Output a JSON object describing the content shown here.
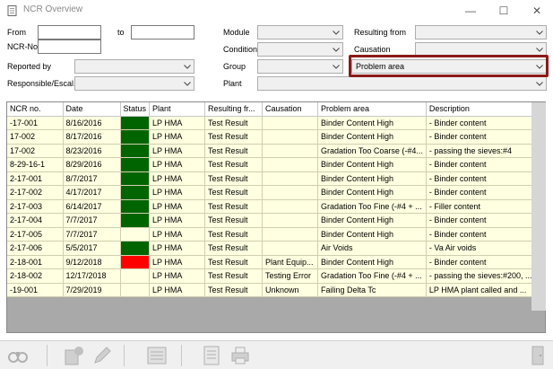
{
  "window": {
    "title": "NCR Overview",
    "minimize_glyph": "—",
    "maximize_glyph": "☐",
    "close_glyph": "✕"
  },
  "filters": {
    "from_label": "From",
    "to_label": "to",
    "ncr_no_label": "NCR-No.",
    "reported_by_label": "Reported by",
    "responsible_label": "Responsible/Escal.",
    "module_label": "Module",
    "condition_label": "Condition",
    "group_label": "Group",
    "plant_label": "Plant",
    "resulting_from_label": "Resulting from",
    "causation_label": "Causation",
    "problem_area_value": "Problem area"
  },
  "colors": {
    "row_bg": "#ffffe1",
    "status_green": "#006400",
    "status_red": "#ff0000",
    "highlight_border": "#8b1a1a"
  },
  "grid": {
    "columns": [
      "NCR no.",
      "Date",
      "Status",
      "Plant",
      "Resulting fr...",
      "Causation",
      "Problem area",
      "Description"
    ],
    "rows": [
      {
        "ncr": "-17-001",
        "date": "8/16/2016",
        "status": "green",
        "plant": "LP HMA",
        "resulting": "Test Result",
        "causation": "",
        "problem": "Binder Content High",
        "description": "- Binder content"
      },
      {
        "ncr": "17-002",
        "date": "8/17/2016",
        "status": "green",
        "plant": "LP HMA",
        "resulting": "Test Result",
        "causation": "",
        "problem": "Binder Content High",
        "description": "- Binder content"
      },
      {
        "ncr": "17-002",
        "date": "8/23/2016",
        "status": "green",
        "plant": "LP HMA",
        "resulting": "Test Result",
        "causation": "",
        "problem": "Gradation Too Coarse (-#4...",
        "description": "- passing the sieves:#4"
      },
      {
        "ncr": "8-29-16-1",
        "date": "8/29/2016",
        "status": "green",
        "plant": "LP HMA",
        "resulting": "Test Result",
        "causation": "",
        "problem": "Binder Content High",
        "description": "- Binder content"
      },
      {
        "ncr": "2-17-001",
        "date": "8/7/2017",
        "status": "green",
        "plant": "LP HMA",
        "resulting": "Test Result",
        "causation": "",
        "problem": "Binder Content High",
        "description": "- Binder content"
      },
      {
        "ncr": "2-17-002",
        "date": "4/17/2017",
        "status": "green",
        "plant": "LP HMA",
        "resulting": "Test Result",
        "causation": "",
        "problem": "Binder Content High",
        "description": "- Binder content"
      },
      {
        "ncr": "2-17-003",
        "date": "6/14/2017",
        "status": "green",
        "plant": "LP HMA",
        "resulting": "Test Result",
        "causation": "",
        "problem": "Gradation Too Fine (-#4 + ...",
        "description": "- Filler content"
      },
      {
        "ncr": "2-17-004",
        "date": "7/7/2017",
        "status": "green",
        "plant": "LP HMA",
        "resulting": "Test Result",
        "causation": "",
        "problem": "Binder Content High",
        "description": "- Binder content"
      },
      {
        "ncr": "2-17-005",
        "date": "7/7/2017",
        "status": "none",
        "plant": "LP HMA",
        "resulting": "Test Result",
        "causation": "",
        "problem": "Binder Content High",
        "description": "- Binder content"
      },
      {
        "ncr": "2-17-006",
        "date": "5/5/2017",
        "status": "green",
        "plant": "LP HMA",
        "resulting": "Test Result",
        "causation": "",
        "problem": "Air Voids",
        "description": "- Va Air voids"
      },
      {
        "ncr": "2-18-001",
        "date": "9/12/2018",
        "status": "red",
        "plant": "LP HMA",
        "resulting": "Test Result",
        "causation": "Plant Equip...",
        "problem": "Binder Content High",
        "description": "- Binder content"
      },
      {
        "ncr": "2-18-002",
        "date": "12/17/2018",
        "status": "none",
        "plant": "LP HMA",
        "resulting": "Test Result",
        "causation": "Testing Error",
        "problem": "Gradation Too Fine (-#4 + ...",
        "description": "- passing the sieves:#200, ..."
      },
      {
        "ncr": "-19-001",
        "date": "7/29/2019",
        "status": "none",
        "plant": "LP HMA",
        "resulting": "Test Result",
        "causation": "Unknown",
        "problem": "Failing Delta Tc",
        "description": "LP HMA plant called and ..."
      }
    ]
  },
  "toolbar": {
    "icons": [
      "binoculars-icon",
      "add-document-icon",
      "edit-pencil-icon",
      "report-icon",
      "print-report-icon",
      "printer-icon",
      "exit-door-icon"
    ]
  }
}
